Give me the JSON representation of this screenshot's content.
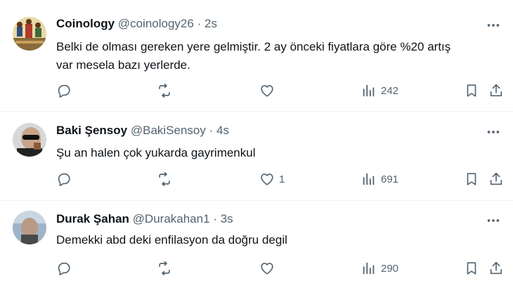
{
  "tweets": [
    {
      "name": "Coinology",
      "handle": "@coinology26",
      "dot": "·",
      "time": "2s",
      "text_lines": [
        "Belki de olması gereken yere gelmiştir. 2 ay önceki fiyatlara göre %20 artış",
        "var mesela bazı yerlerde."
      ],
      "reply_count": "",
      "retweet_count": "",
      "like_count": "",
      "views": "242"
    },
    {
      "name": "Baki Şensoy",
      "handle": "@BakiSensoy",
      "dot": "·",
      "time": "4s",
      "text_lines": [
        "Şu an halen çok yukarda gayrimenkul"
      ],
      "reply_count": "",
      "retweet_count": "",
      "like_count": "1",
      "views": "691"
    },
    {
      "name": "Durak Şahan",
      "handle": "@Durakahan1",
      "dot": "·",
      "time": "3s",
      "text_lines": [
        "Demekki abd deki enfilasyon da doğru degil"
      ],
      "reply_count": "",
      "retweet_count": "",
      "like_count": "",
      "views": "290"
    }
  ],
  "icons": {
    "more": "more-icon",
    "reply": "reply-icon",
    "retweet": "retweet-icon",
    "like": "heart-icon",
    "views": "views-icon",
    "bookmark": "bookmark-icon",
    "share": "share-icon"
  },
  "colors": {
    "text": "#0f1419",
    "secondary": "#536471",
    "divider": "#eff3f4"
  }
}
